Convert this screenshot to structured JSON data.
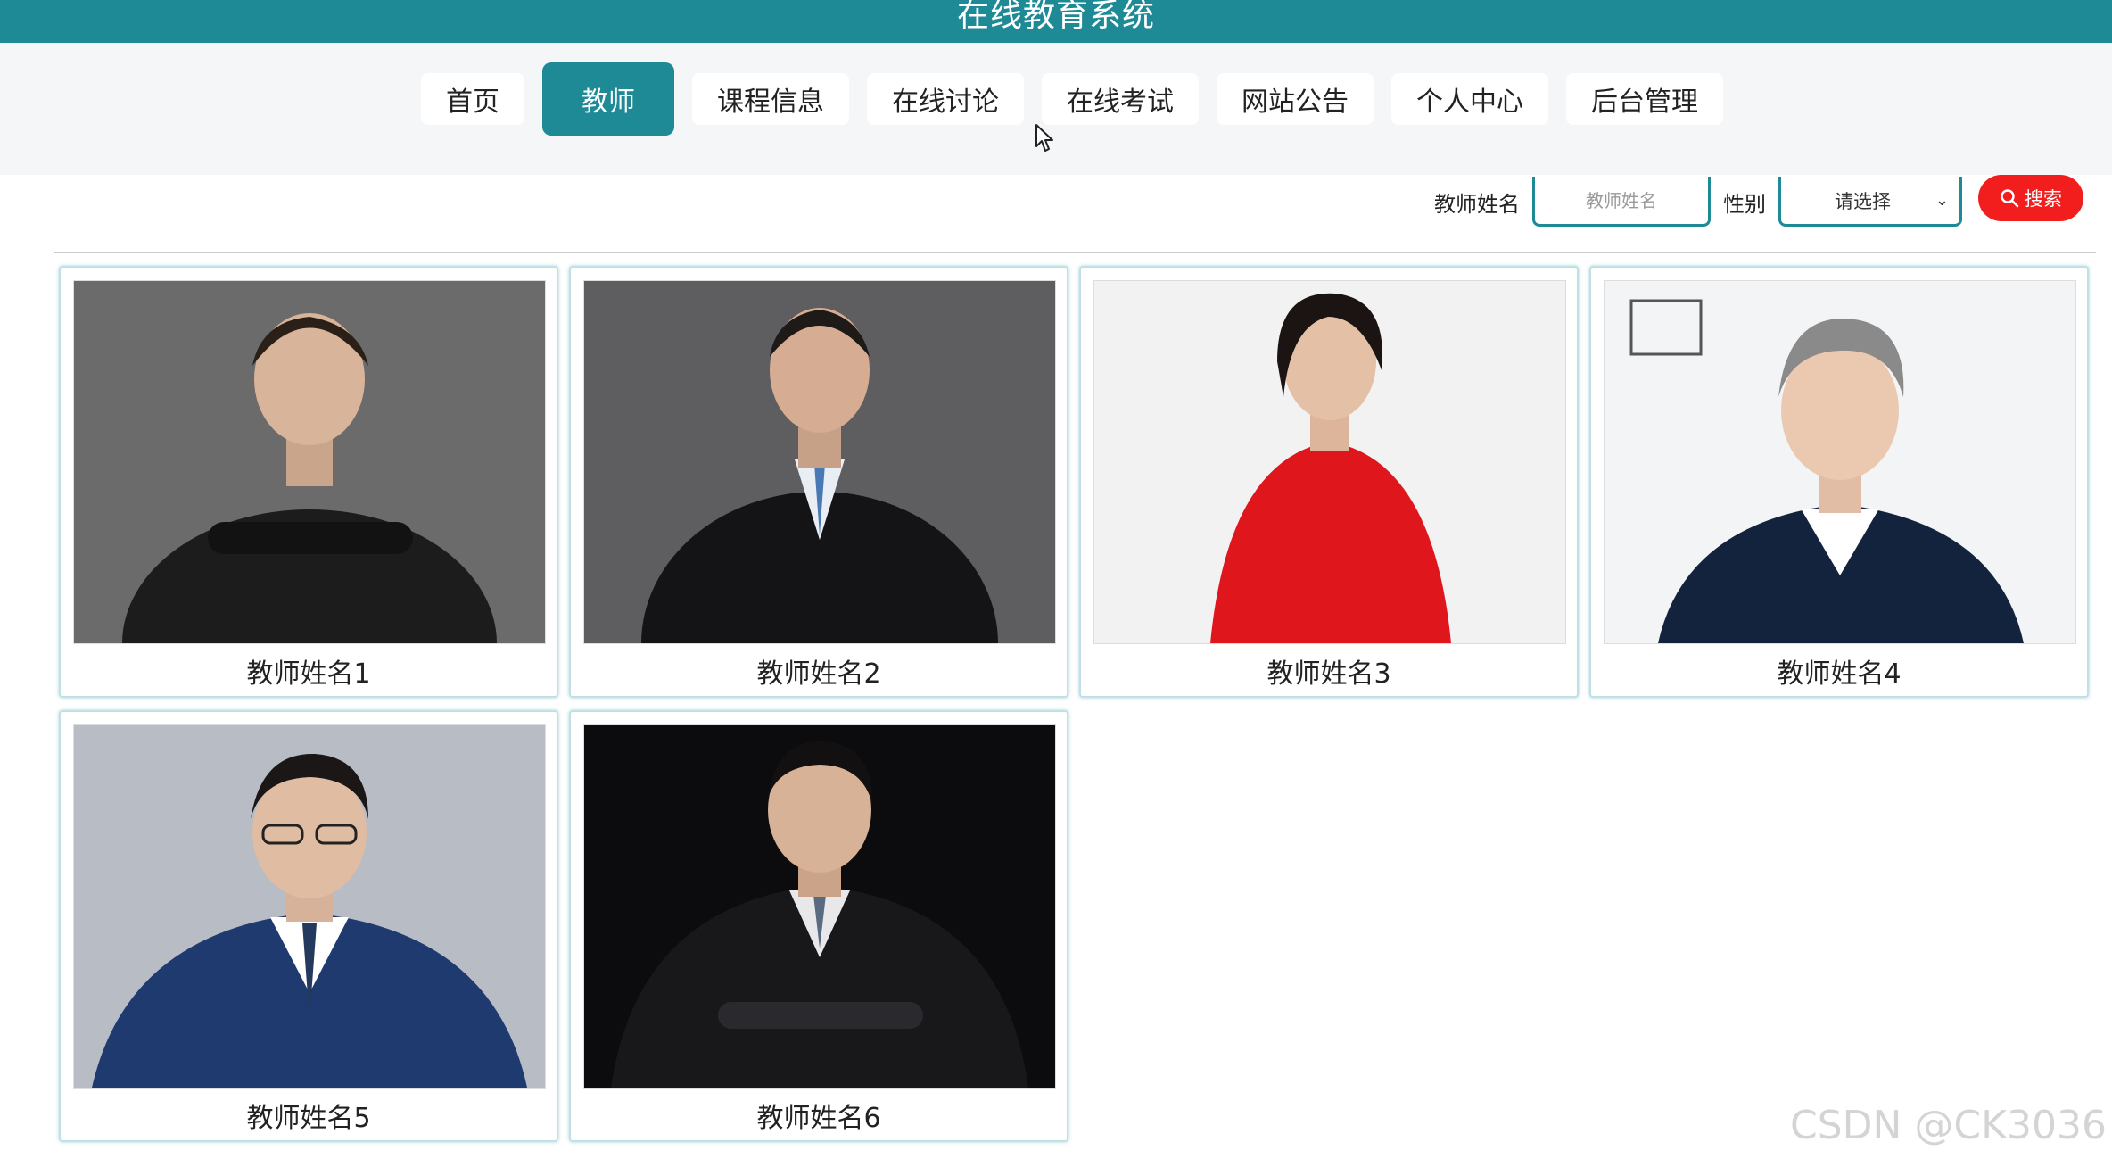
{
  "header": {
    "title": "在线教育系统"
  },
  "nav": {
    "items": [
      {
        "label": "首页"
      },
      {
        "label": "教师"
      },
      {
        "label": "课程信息"
      },
      {
        "label": "在线讨论"
      },
      {
        "label": "在线考试"
      },
      {
        "label": "网站公告"
      },
      {
        "label": "个人中心"
      },
      {
        "label": "后台管理"
      }
    ],
    "active": "教师"
  },
  "search": {
    "name_label": "教师姓名",
    "name_placeholder": "教师姓名",
    "gender_label": "性别",
    "gender_selected": "请选择",
    "button_label": "搜索"
  },
  "teachers": [
    {
      "name": "教师姓名1"
    },
    {
      "name": "教师姓名2"
    },
    {
      "name": "教师姓名3"
    },
    {
      "name": "教师姓名4"
    },
    {
      "name": "教师姓名5"
    },
    {
      "name": "教师姓名6"
    }
  ],
  "watermark": "CSDN @CK3036",
  "colors": {
    "accent": "#1e8a96",
    "search_button": "#f21e1e"
  }
}
